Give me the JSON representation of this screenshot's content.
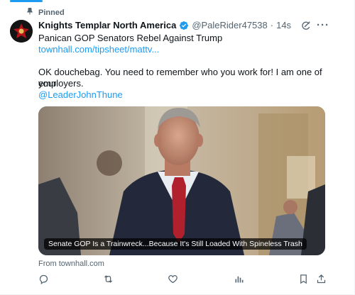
{
  "pinned_label": "Pinned",
  "tweet": {
    "display_name": "Knights Templar North America",
    "handle": "@PaleRider47538",
    "dot": "·",
    "time": "14s",
    "title_line": "Panican GOP Senators Rebel Against Trump",
    "link_text": "townhall.com/tipsheet/mattv...",
    "body_line1": "OK douchebag. You need to remember who you work for! I am one of your",
    "body_line2": "employers.",
    "mention": "@LeaderJohnThune"
  },
  "card": {
    "caption": "Senate GOP Is a Trainwreck...Because It's Still Loaded With Spineless Trash",
    "source": "From townhall.com"
  },
  "icons": {
    "pin": "pin-icon",
    "verified": "verified-badge-icon",
    "grok": "grok-icon",
    "more": "more-icon",
    "reply": "reply-icon",
    "retweet": "retweet-icon",
    "like": "like-icon",
    "views": "views-icon",
    "bookmark": "bookmark-icon",
    "share": "share-icon"
  },
  "colors": {
    "accent": "#1d9bf0",
    "secondary_text": "#536471",
    "primary_text": "#0f1419"
  }
}
